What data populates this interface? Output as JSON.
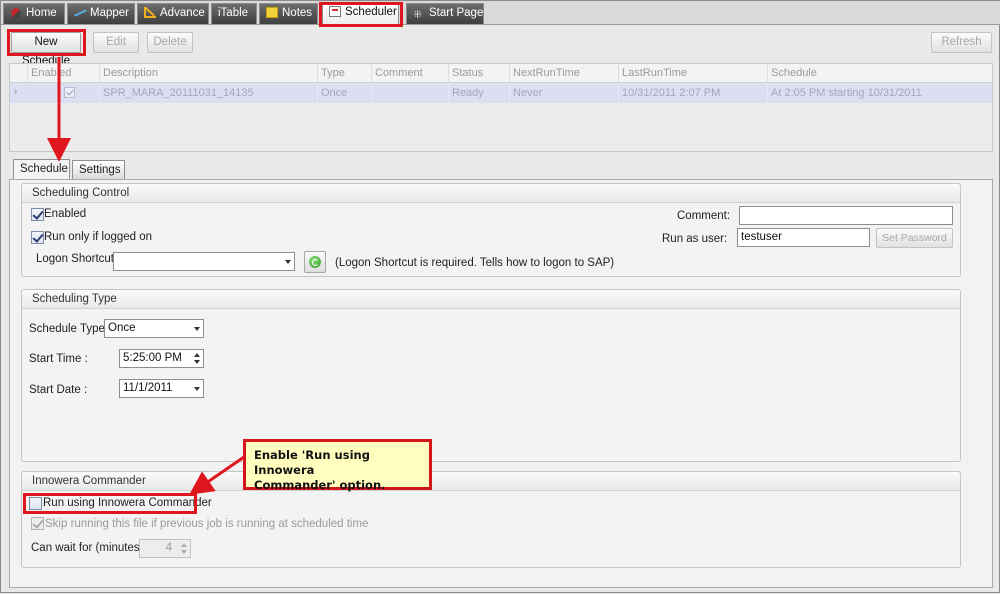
{
  "top_tabs": [
    {
      "label": "Home",
      "icon": "home-icon"
    },
    {
      "label": "Mapper",
      "icon": "mapper-icon"
    },
    {
      "label": "Advance",
      "icon": "advance-icon"
    },
    {
      "label": "iTable",
      "icon": ""
    },
    {
      "label": "Notes",
      "icon": "notes-icon"
    },
    {
      "label": "Scheduler",
      "icon": "scheduler-icon",
      "active": true
    },
    {
      "label": "Start Page",
      "icon": "start-page-icon"
    }
  ],
  "toolbar": {
    "new_schedule": "New Schedule",
    "edit": "Edit",
    "delete": "Delete",
    "refresh": "Refresh"
  },
  "grid": {
    "columns": [
      "Enabled",
      "Description",
      "Type",
      "Comment",
      "Status",
      "NextRunTime",
      "LastRunTime",
      "Schedule"
    ],
    "rows": [
      {
        "enabled": true,
        "description": "SPR_MARA_20111031_14135",
        "type": "Once",
        "comment": "",
        "status": "Ready",
        "next_run_time": "Never",
        "last_run_time": "10/31/2011 2:07 PM",
        "schedule": "At 2:05 PM starting 10/31/2011"
      }
    ],
    "row_indicator": "›"
  },
  "inner_tabs": [
    "Schedule",
    "Settings"
  ],
  "scheduling_control": {
    "title": "Scheduling Control",
    "enabled_label": "Enabled",
    "enabled_checked": true,
    "run_logged_on_label": "Run only if logged on",
    "run_logged_on_checked": true,
    "logon_shortcut_label": "Logon Shortcut",
    "logon_shortcut_value": "",
    "logon_shortcut_note": "(Logon Shortcut is required. Tells how to logon to SAP)",
    "comment_label": "Comment:",
    "comment_value": "",
    "run_as_user_label": "Run as user:",
    "run_as_user_value": "testuser",
    "set_password": "Set Password"
  },
  "scheduling_type": {
    "title": "Scheduling Type",
    "schedule_type_label": "Schedule Type:",
    "schedule_type_value": "Once",
    "start_time_label": "Start Time :",
    "start_time_value": "5:25:00 PM",
    "start_date_label": "Start Date :",
    "start_date_value": "11/1/2011"
  },
  "innowera_commander": {
    "title": "Innowera Commander",
    "run_using_label": "Run using Innowera Commander",
    "run_using_checked": false,
    "skip_label": "Skip running this file if previous job is running at scheduled time",
    "skip_checked": true,
    "can_wait_label": "Can wait for (minutes)",
    "can_wait_value": "4"
  },
  "callout": {
    "line1": "Enable 'Run using Innowera",
    "line2": "Commander' option."
  },
  "colors": {
    "highlight": "#e0161e",
    "callout_bg": "#fffebe",
    "selected_row": "#dcdff1"
  }
}
